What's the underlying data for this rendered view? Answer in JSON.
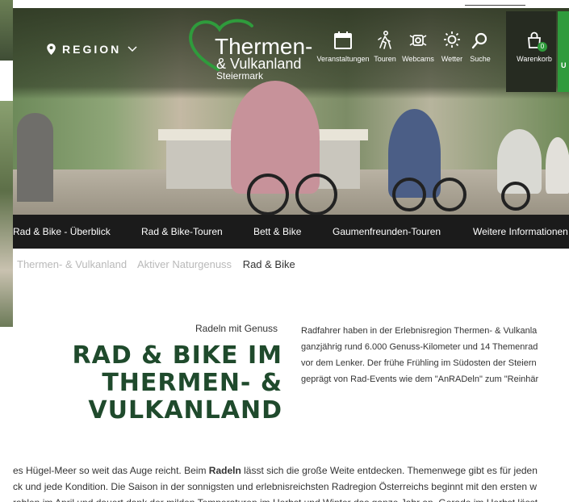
{
  "header": {
    "region_label": "REGION",
    "logo": {
      "name": "Thermen-",
      "sub1": "& Vulkanland",
      "sub2": "Steiermark"
    },
    "nav": [
      {
        "label": "Veranstaltungen",
        "icon": "calendar-icon"
      },
      {
        "label": "Touren",
        "icon": "hiker-icon"
      },
      {
        "label": "Webcams",
        "icon": "webcam-icon"
      },
      {
        "label": "Wetter",
        "icon": "sun-icon"
      },
      {
        "label": "Suche",
        "icon": "search-icon"
      }
    ],
    "cart": {
      "label": "Warenkorb",
      "count": "0",
      "icon": "shopping-bag-icon"
    },
    "green_button_label": "U"
  },
  "subnav": [
    "Rad & Bike - Überblick",
    "Rad & Bike-Touren",
    "Bett & Bike",
    "Gaumenfreunden-Touren",
    "Weitere Informationen"
  ],
  "breadcrumb": [
    "Thermen- & Vulkanland",
    "Aktiver Naturgenuss",
    "Rad & Bike"
  ],
  "intro": {
    "kicker": "Radeln mit Genuss",
    "headline_lines": [
      "RAD & BIKE IM",
      "THERMEN- &",
      "VULKANLAND"
    ],
    "text_lines": [
      "Radfahrer haben in der Erlebnisregion Thermen- & Vulkanla",
      "ganzjährig rund 6.000 Genuss-Kilometer und 14 Themenrad",
      "vor dem Lenker. Der frühe Frühling im Südosten der Steiern",
      "geprägt von Rad-Events wie dem \"AnRADeln\" zum \"Reinhär"
    ]
  },
  "body": {
    "line1_a": "es Hügel-Meer so weit das Auge reicht. Beim ",
    "line1_bold": "Radeln",
    "line1_b": " lässt sich die große Weite entdecken. Themenwege gibt es für jeden",
    "line2": "ck und jede Kondition. Die Saison in der sonnigsten und erlebnisreichsten Radregion Österreichs beginnt mit den ersten w",
    "line3": "rablen im April und dauert dank der milden Temperaturen im Herbst und Winter das ganze Jahr an. Gerade im Herbst lässt"
  },
  "colors": {
    "headline": "#1f4a2c",
    "logo_heart": "#2f9b3c",
    "cart_badge": "#2e9b3a",
    "subnav_bg": "#1b1b1b",
    "green_button": "#2f9b3c"
  }
}
